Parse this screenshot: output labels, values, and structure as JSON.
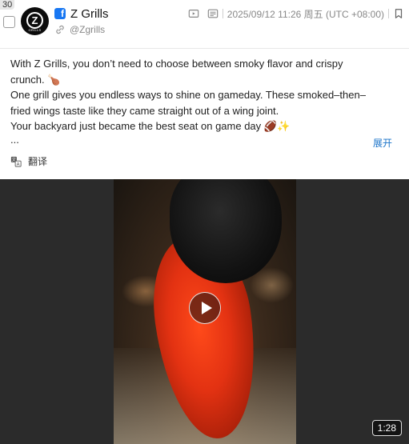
{
  "post": {
    "index": "30",
    "author": {
      "name": "Z Grills",
      "handle": "@Zgrills",
      "avatar_text": "Z",
      "avatar_brand": "GRILLS"
    },
    "platform_icon": "facebook-icon",
    "timestamp": "2025/09/12 11:26 周五 (UTC +08:00)",
    "text_lines": [
      "With Z Grills, you don’t need to choose between smoky flavor and crispy",
      "crunch. 🍗",
      "One grill gives you endless ways to shine on gameday. These smoked–then–",
      "fried wings taste like they came straight out of a wing joint.",
      "Your backyard just became the best seat on game day 🏈✨"
    ],
    "ellipsis": "...",
    "expand_label": "展开",
    "translate_label": "翻译",
    "video": {
      "duration": "1:28"
    }
  },
  "icons": {
    "video": "video-icon",
    "image": "image-icon",
    "bookmark": "bookmark-icon",
    "link": "link-icon",
    "translate": "translate-icon",
    "play": "play-icon"
  },
  "colors": {
    "facebook": "#1877f2",
    "link": "#1a73c9",
    "video_bg": "#2b2b2b"
  }
}
